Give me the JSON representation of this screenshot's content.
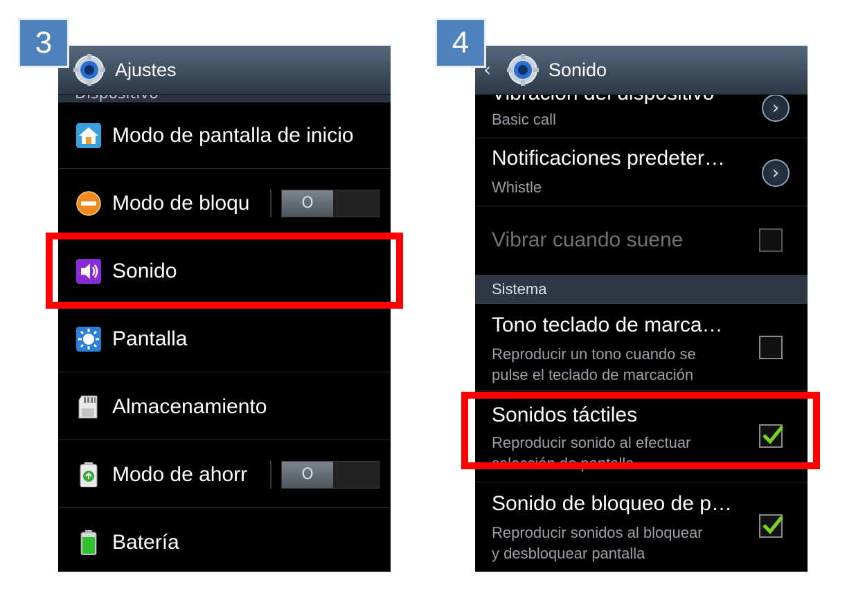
{
  "left": {
    "badge": "3",
    "title": "Ajustes",
    "section_partial": "Dispositivo",
    "items": [
      {
        "label": "Modo de pantalla de inicio",
        "icon": "home-icon"
      },
      {
        "label": "Modo de bloqu",
        "icon": "block-mode-icon",
        "toggle": "O"
      },
      {
        "label": "Sonido",
        "icon": "speaker-icon"
      },
      {
        "label": "Pantalla",
        "icon": "display-brightness-icon"
      },
      {
        "label": "Almacenamiento",
        "icon": "sd-card-icon"
      },
      {
        "label": "Modo de ahorr",
        "icon": "power-saving-icon",
        "toggle": "O"
      },
      {
        "label": "Batería",
        "icon": "battery-icon"
      }
    ]
  },
  "right": {
    "badge": "4",
    "title": "Sonido",
    "back_icon": "back-chevron-icon",
    "items": [
      {
        "title": "Vibración del dispositivo",
        "sub": "Basic call"
      },
      {
        "title": "Notificaciones predeter…",
        "sub": "Whistle"
      },
      {
        "title": "Vibrar cuando suene"
      }
    ],
    "section_header": "Sistema",
    "system_items": [
      {
        "title": "Tono teclado de marca…",
        "sub1": "Reproducir un tono cuando se",
        "sub2": "pulse el teclado de marcación",
        "checked": false
      },
      {
        "title": "Sonidos táctiles",
        "sub1": "Reproducir sonido al efectuar",
        "sub2": "selección de pantalla",
        "checked": true
      },
      {
        "title": "Sonido de bloqueo de p…",
        "sub1": "Reproducir sonidos al bloquear",
        "sub2": "y desbloquear pantalla",
        "checked": true
      }
    ]
  },
  "colors": {
    "highlight": "#ff0000",
    "badge": "#4f81bd",
    "checkmark": "#7ed321",
    "action_bar": "#3e4e5e"
  }
}
